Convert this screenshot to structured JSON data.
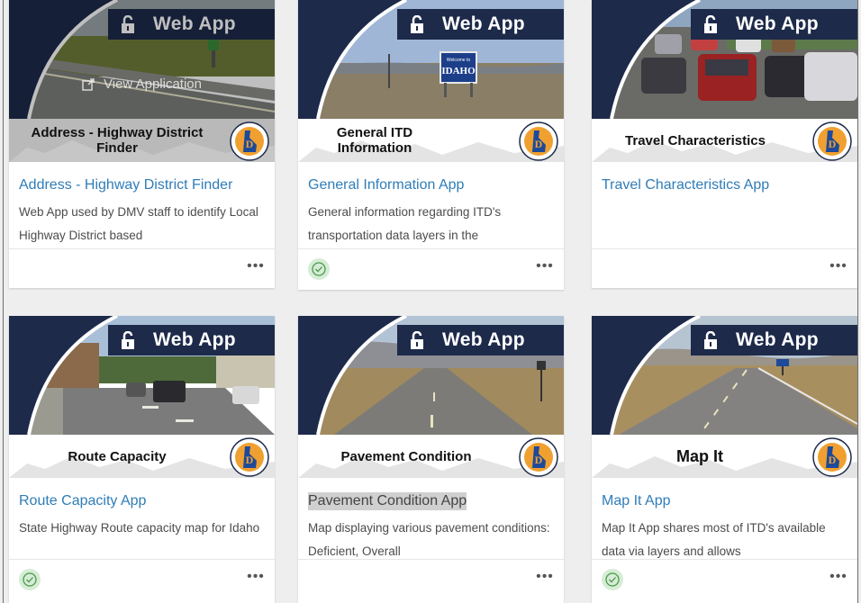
{
  "banner_label": "Web App",
  "hover_label": "View Application",
  "colors": {
    "banner": "#1d2a4a",
    "link": "#2f7db8",
    "check_bg": "#d6ecd6",
    "check_stroke": "#4a9a4a"
  },
  "icons": {
    "lock": "unlock-icon",
    "more": "more-options-icon",
    "check": "checkmark-icon",
    "logo": "idaho-itd-logo"
  },
  "cards": [
    {
      "thumb_title": "Address - Highway District Finder",
      "title": "Address - Highway District Finder",
      "description": "Web App used by DMV staff to identify Local Highway District based",
      "checked": false,
      "highlight": false
    },
    {
      "thumb_title": "General ITD Information",
      "title": "General Information App",
      "description": "General information regarding ITD's transportation data layers in the",
      "checked": true,
      "highlight": false,
      "sign_text": "Welcome to IDAHO"
    },
    {
      "thumb_title": "Travel Characteristics",
      "title": "Travel Characteristics App",
      "description": "",
      "checked": false,
      "highlight": false
    },
    {
      "thumb_title": "Route Capacity",
      "title": "Route Capacity App",
      "description": "State Highway Route capacity map for Idaho",
      "checked": true,
      "highlight": false
    },
    {
      "thumb_title": "Pavement Condition",
      "title": "Pavement Condition App",
      "description": "Map displaying various pavement conditions: Deficient, Overall",
      "checked": false,
      "highlight": true
    },
    {
      "thumb_title": "Map It",
      "title": "Map It App",
      "description": "Map It App shares most of ITD's available data via layers and allows",
      "checked": true,
      "highlight": false
    }
  ]
}
